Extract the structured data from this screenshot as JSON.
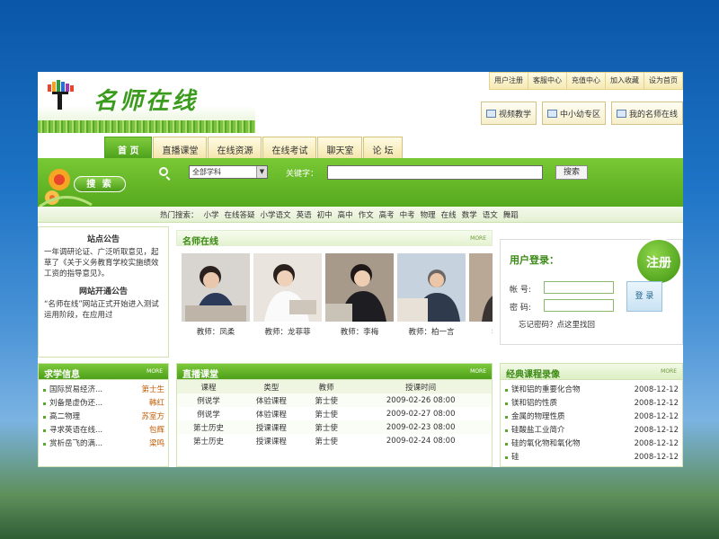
{
  "header": {
    "logo_text": "名师在线",
    "top_links": [
      "用户注册",
      "客服中心",
      "充值中心",
      "加入收藏",
      "设为首页"
    ],
    "feature_buttons": [
      "视频教学",
      "中小幼专区",
      "我的名师在线"
    ]
  },
  "nav": [
    "首 页",
    "直播课堂",
    "在线资源",
    "在线考试",
    "聊天室",
    "论 坛"
  ],
  "search": {
    "badge": "搜 索",
    "subject": "全部学科",
    "keyword_label": "关键字：",
    "button": "搜索",
    "hot_label": "热门搜索：",
    "hot_terms": [
      "小学",
      "在线答疑",
      "小学语文",
      "英语",
      "初中",
      "高中",
      "作文",
      "高考",
      "中考",
      "物理",
      "在线",
      "数学",
      "语文",
      "舞蹈"
    ]
  },
  "notice": {
    "title": "站点公告",
    "text1": "一年调研论证、广泛听取意见，起草了《关于义务教育学校实施绩效工资的指导意见》。",
    "title2": "网站开通公告",
    "text2": "“名师在线”网站正式开始进入测试运用阶段，在应用过"
  },
  "teachers": {
    "title": "名师在线",
    "more": "MORE",
    "names": [
      "教师：凤柔",
      "教师：龙菲菲",
      "教师：李梅",
      "教师：柏一言",
      "教师："
    ]
  },
  "login": {
    "title": "用户登录：",
    "register": "注册",
    "account_label": "帐 号:",
    "password_label": "密 码:",
    "button": "登 录",
    "forgot": "忘记密码？点这里找回"
  },
  "qiuxue": {
    "title": "求学信息",
    "more": "MORE",
    "items": [
      {
        "title": "国际贸易经济...",
        "name": "第士生"
      },
      {
        "title": "刘备是虚伪还...",
        "name": "韩红"
      },
      {
        "title": "高二物理",
        "name": "苏室方"
      },
      {
        "title": "寻求英语在线...",
        "name": "包辉"
      },
      {
        "title": "赏析岳飞的满...",
        "name": "梁鸣"
      }
    ]
  },
  "live": {
    "title": "直播课堂",
    "more": "MORE",
    "columns": [
      "课程",
      "类型",
      "教师",
      "授课时间"
    ],
    "rows": [
      [
        "例说学",
        "体验课程",
        "第士使",
        "2009-02-26 08:00"
      ],
      [
        "例说学",
        "体验课程",
        "第士使",
        "2009-02-27 08:00"
      ],
      [
        "第士历史",
        "授课课程",
        "第士使",
        "2009-02-23 08:00"
      ],
      [
        "第士历史",
        "授课课程",
        "第士使",
        "2009-02-24 08:00"
      ]
    ]
  },
  "classic": {
    "title": "经典课程录像",
    "more": "MORE",
    "items": [
      {
        "title": "镁和铝的重要化合物",
        "date": "2008-12-12"
      },
      {
        "title": "镁和铝的性质",
        "date": "2008-12-12"
      },
      {
        "title": "金属的物理性质",
        "date": "2008-12-12"
      },
      {
        "title": "硅酸盐工业简介",
        "date": "2008-12-12"
      },
      {
        "title": "硅的氧化物和氧化物",
        "date": "2008-12-12"
      },
      {
        "title": "硅",
        "date": "2008-12-12"
      }
    ]
  }
}
